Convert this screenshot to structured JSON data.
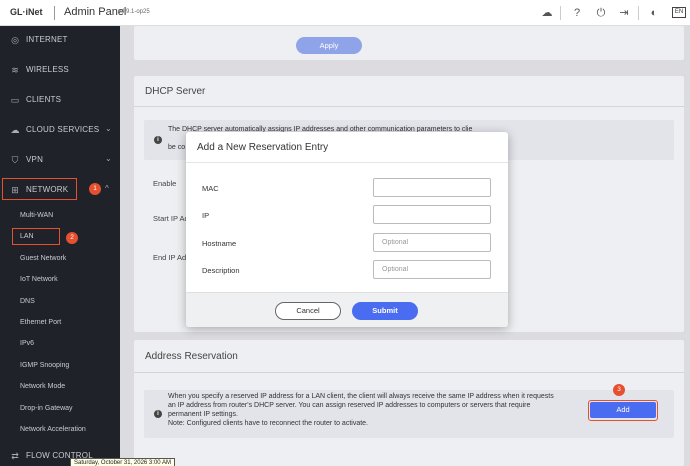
{
  "topbar": {
    "logo": "GL·iNet",
    "title": "Admin Panel",
    "version": "v4.9.1-op25",
    "language": "EN",
    "icons": [
      "cloud-icon",
      "help-icon",
      "power-icon",
      "logout-icon",
      "theme-icon"
    ]
  },
  "sidebar": {
    "items": [
      {
        "label": "INTERNET",
        "icon": "globe-icon"
      },
      {
        "label": "WIRELESS",
        "icon": "wifi-icon"
      },
      {
        "label": "CLIENTS",
        "icon": "clients-icon"
      },
      {
        "label": "CLOUD SERVICES",
        "icon": "cloud-icon"
      },
      {
        "label": "VPN",
        "icon": "shield-icon"
      },
      {
        "label": "NETWORK",
        "icon": "network-icon"
      }
    ],
    "network_sub": [
      "Multi-WAN",
      "LAN",
      "Guest Network",
      "IoT Network",
      "DNS",
      "Ethernet Port",
      "IPv6",
      "IGMP Snooping",
      "Network Mode",
      "Drop-in Gateway",
      "Network Acceleration"
    ],
    "flow_control": "FLOW CONTROL",
    "badges": [
      "1",
      "2",
      "3"
    ]
  },
  "main": {
    "apply_label": "Apply",
    "dhcp": {
      "title": "DHCP Server",
      "info": "The DHCP server automatically assigns IP addresses and other communication parameters to clie",
      "info2": "be co",
      "enable_label": "Enable",
      "start_ip_label": "Start IP Ad",
      "end_ip_label": "End IP Ad"
    },
    "reservation": {
      "title": "Address Reservation",
      "info_line1": "When you specify a reserved IP address for a LAN client, the client will always receive the same IP address when it requests",
      "info_line2": "an IP address from router's DHCP server. You can assign reserved IP addresses to computers or servers that require",
      "info_line3": "permanent IP settings.",
      "info_line4": "Note: Configured clients have to reconnect the router to activate.",
      "add_label": "Add"
    }
  },
  "modal": {
    "title": "Add a New Reservation Entry",
    "fields": [
      {
        "label": "MAC",
        "value": "",
        "placeholder": ""
      },
      {
        "label": "IP",
        "value": "",
        "placeholder": ""
      },
      {
        "label": "Hostname",
        "value": "",
        "placeholder": "Optional"
      },
      {
        "label": "Description",
        "value": "",
        "placeholder": "Optional"
      }
    ],
    "cancel_label": "Cancel",
    "submit_label": "Submit"
  },
  "tooltip": "Saturday, October 31, 2026 3:00 AM",
  "colors": {
    "accent": "#4a6cf0",
    "highlight": "#e5502f",
    "sidebar_bg": "#1f2329"
  }
}
